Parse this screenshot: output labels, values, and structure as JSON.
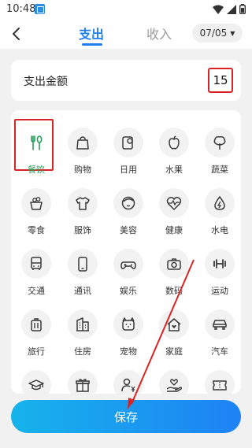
{
  "status_bar": {
    "time": "10:48"
  },
  "header": {
    "tab_expense": "支出",
    "tab_income": "收入",
    "date": "07/05"
  },
  "amount": {
    "label": "支出金额",
    "value": "15"
  },
  "categories": [
    {
      "label": "餐饮",
      "icon": "fork-spoon-icon"
    },
    {
      "label": "购物",
      "icon": "shopping-bag-icon"
    },
    {
      "label": "日用",
      "icon": "tissue-roll-icon"
    },
    {
      "label": "水果",
      "icon": "apple-icon"
    },
    {
      "label": "蔬菜",
      "icon": "vegetable-icon"
    },
    {
      "label": "零食",
      "icon": "snack-basket-icon"
    },
    {
      "label": "服饰",
      "icon": "tshirt-icon"
    },
    {
      "label": "美容",
      "icon": "face-icon"
    },
    {
      "label": "健康",
      "icon": "heartbeat-icon"
    },
    {
      "label": "水电",
      "icon": "water-electric-icon"
    },
    {
      "label": "交通",
      "icon": "bus-icon"
    },
    {
      "label": "通讯",
      "icon": "phone-icon"
    },
    {
      "label": "娱乐",
      "icon": "gamepad-icon"
    },
    {
      "label": "数码",
      "icon": "camera-icon"
    },
    {
      "label": "运动",
      "icon": "dumbbell-icon"
    },
    {
      "label": "旅行",
      "icon": "suitcase-icon"
    },
    {
      "label": "住房",
      "icon": "building-icon"
    },
    {
      "label": "宠物",
      "icon": "pet-icon"
    },
    {
      "label": "家庭",
      "icon": "house-icon"
    },
    {
      "label": "汽车",
      "icon": "car-icon"
    },
    {
      "label": "教育",
      "icon": "graduation-cap-icon"
    },
    {
      "label": "礼金",
      "icon": "gift-icon"
    },
    {
      "label": "税金",
      "icon": "tax-person-icon"
    },
    {
      "label": "捐赠",
      "icon": "donate-hand-icon"
    },
    {
      "label": "彩票",
      "icon": "lottery-ticket-icon"
    }
  ],
  "selected_category": "餐饮",
  "save_label": "保存",
  "colors": {
    "accent": "#1e7ef0",
    "selected_icon": "#2a9d5a",
    "annotation_red": "#d82424",
    "save_gradient_start": "#16b3ea",
    "save_gradient_end": "#1e82f5"
  }
}
